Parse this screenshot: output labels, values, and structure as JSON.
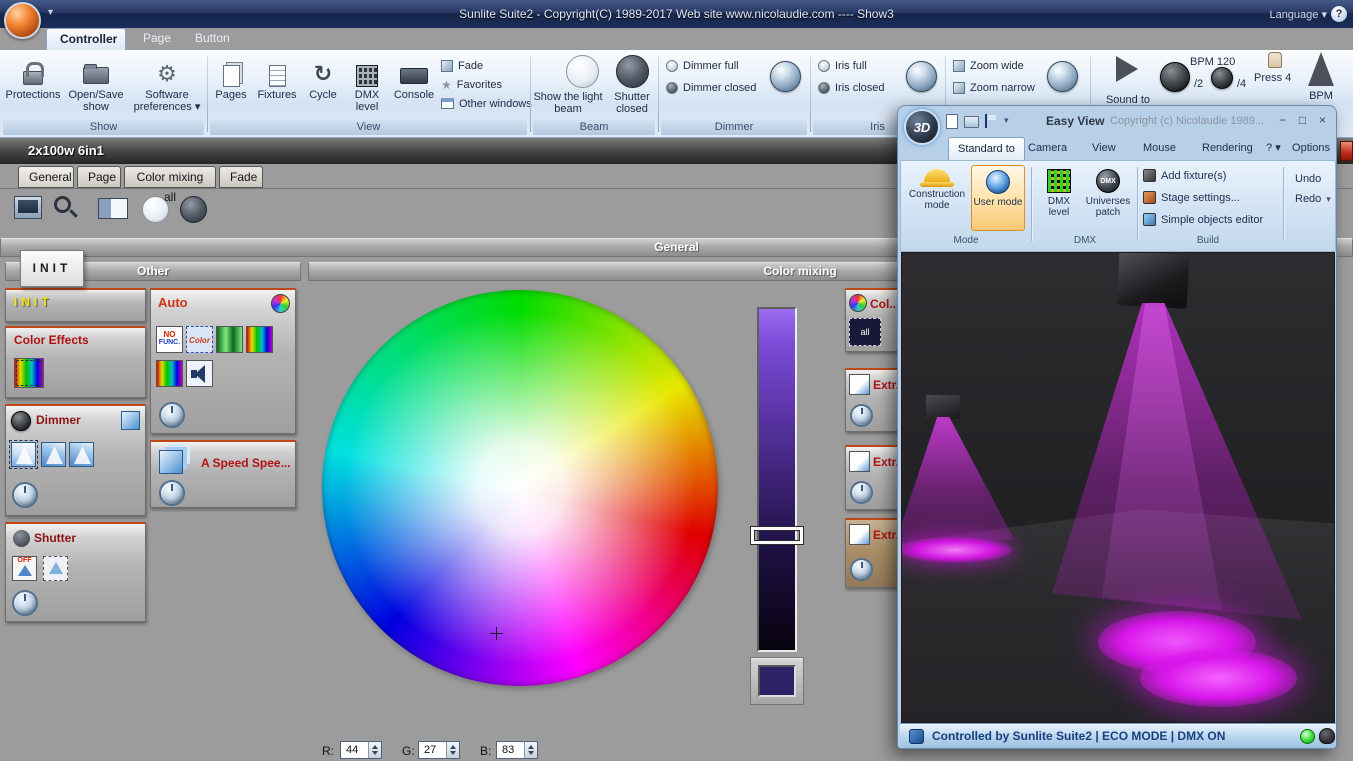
{
  "icons": {
    "dropdown": "▾",
    "gear": "⚙",
    "cycle": "↻",
    "star": "★",
    "minimize": "−",
    "maximize": "□",
    "close": "×",
    "help": "?"
  },
  "colors": {
    "beam_magenta": "#d616e6",
    "swatch_current": "#2e2166",
    "slider_top": "#8a5ae0",
    "panel_accent_red": "#c04818",
    "titlebar_navy": "#1c2e59"
  },
  "titlebar": {
    "title": "Sunlite Suite2 - Copyright(C) 1989-2017    Web site www.nicolaudie.com ---- Show3",
    "language": "Language"
  },
  "ribbon_tabs": {
    "controller": "Controller",
    "page": "Page",
    "button": "Button"
  },
  "ribbon": {
    "show": {
      "label": "Show",
      "protections": "Protections",
      "open_save": "Open/Save show",
      "preferences": "Software preferences"
    },
    "view": {
      "label": "View",
      "pages": "Pages",
      "fixtures": "Fixtures",
      "cycle": "Cycle",
      "dmx_level": "DMX level",
      "console": "Console",
      "fade": "Fade",
      "favorites": "Favorites",
      "other_windows": "Other windows"
    },
    "beam": {
      "label": "Beam",
      "show_beam": "Show the light beam",
      "shutter_closed": "Shutter closed"
    },
    "dimmer": {
      "label": "Dimmer",
      "full": "Dimmer full",
      "closed": "Dimmer closed"
    },
    "iris": {
      "label": "Iris",
      "full": "Iris full",
      "closed": "Iris closed"
    },
    "zoom": {
      "wide": "Zoom wide",
      "narrow": "Zoom narrow"
    },
    "sound": {
      "sound_to": "Sound to",
      "bpm_value": "BPM 120",
      "div2": "/2",
      "div4": "/4",
      "press": "Press 4",
      "bpm": "BPM"
    }
  },
  "doc": {
    "title": "2x100w 6in1",
    "tabs": [
      "General",
      "Page",
      "Color mixing all",
      "Fade"
    ],
    "section_header": "General"
  },
  "left": {
    "header": "Other",
    "init_tab": "INIT",
    "init_button": "INIT",
    "color_effects": "Color Effects",
    "dimmer": "Dimmer",
    "shutter": "Shutter",
    "off": "OFF",
    "auto": "Auto",
    "no_func_top": "NO",
    "no_func_bottom": "FUNC.",
    "color_icon": "Color",
    "speed": "A Speed Spee..."
  },
  "mixing": {
    "header": "Color mixing",
    "r_label": "R:",
    "r_value": "44",
    "g_label": "G:",
    "g_value": "27",
    "b_label": "B:",
    "b_value": "83"
  },
  "right_buttons": {
    "col": "Col...",
    "col_icon_text": "all",
    "extra": "Extr..."
  },
  "easyview": {
    "logo": "3D",
    "title": "Easy View",
    "copyright": "Copyright (c) Nicolaudie 1989...",
    "tabs": [
      "Standard to",
      "Camera",
      "View",
      "Mouse",
      "Rendering"
    ],
    "options": "Options",
    "construction_mode": "Construction mode",
    "user_mode": "User mode",
    "group_mode": "Mode",
    "dmx_level": "DMX level",
    "universes_patch": "Universes patch",
    "dmx_sphere": "DMX",
    "group_dmx": "DMX",
    "add_fixtures": "Add fixture(s)",
    "stage_settings": "Stage settings...",
    "simple_objects": "Simple objects editor",
    "group_build": "Build",
    "undo": "Undo",
    "redo": "Redo",
    "status": "Controlled by Sunlite Suite2   |   ECO MODE   |   DMX ON"
  }
}
